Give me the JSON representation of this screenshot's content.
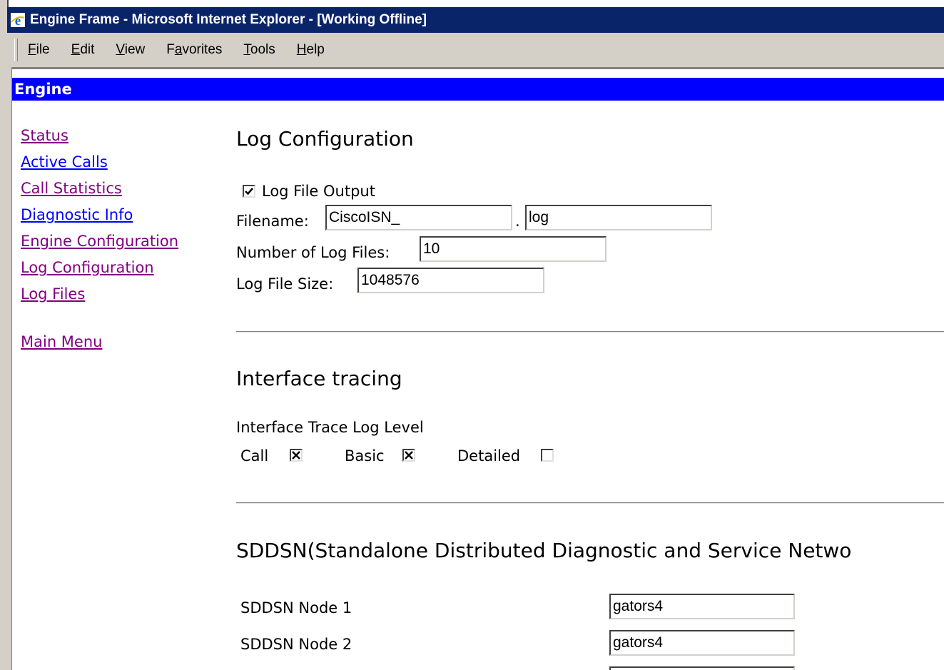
{
  "window": {
    "title": "Engine Frame - Microsoft Internet Explorer - [Working Offline]"
  },
  "menubar": {
    "items": [
      {
        "label": "File",
        "mnemonic": "F",
        "rest": "ile"
      },
      {
        "label": "Edit",
        "mnemonic": "E",
        "rest": "dit"
      },
      {
        "label": "View",
        "mnemonic": "V",
        "rest": "iew"
      },
      {
        "label": "Favorites",
        "pre": "F",
        "mnemonic": "a",
        "rest": "vorites"
      },
      {
        "label": "Tools",
        "mnemonic": "T",
        "rest": "ools"
      },
      {
        "label": "Help",
        "mnemonic": "H",
        "rest": "elp"
      }
    ]
  },
  "header": {
    "title": "Engine"
  },
  "nav": {
    "status": "Status",
    "active_calls": "Active Calls",
    "call_statistics": "Call Statistics",
    "diagnostic_info": "Diagnostic Info",
    "engine_configuration": "Engine Configuration",
    "log_configuration": "Log Configuration",
    "log_files": "Log Files",
    "main_menu": "Main Menu"
  },
  "log_config": {
    "heading": "Log Configuration",
    "log_file_output_label": "Log File Output",
    "log_file_output_checked": true,
    "filename_label": "Filename:",
    "filename_base": "CiscoISN_",
    "filename_dot": ".",
    "filename_ext": "log",
    "num_files_label": "Number of Log Files:",
    "num_files": "10",
    "file_size_label": "Log File Size:",
    "file_size": "1048576"
  },
  "interface_tracing": {
    "heading": "Interface tracing",
    "level_label": "Interface Trace Log Level",
    "call_label": "Call",
    "call_checked": true,
    "basic_label": "Basic",
    "basic_checked": true,
    "detailed_label": "Detailed",
    "detailed_checked": false
  },
  "sddsn": {
    "heading": "SDDSN(Standalone Distributed Diagnostic and Service Netwo",
    "node1_label": "SDDSN Node 1",
    "node1_value": "gators4",
    "node2_label": "SDDSN Node 2",
    "node2_value": "gators4"
  }
}
